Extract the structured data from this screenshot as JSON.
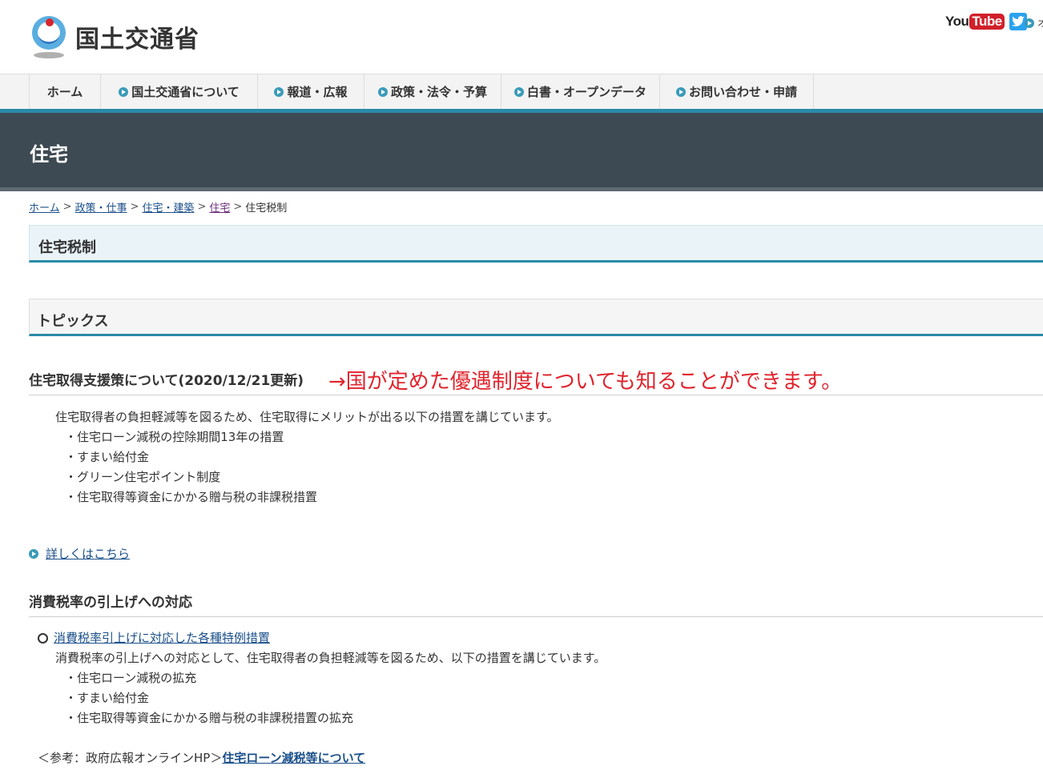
{
  "header": {
    "logo_text": "国土交通省",
    "youtube_you": "You",
    "youtube_tube": "Tube",
    "top_link_label": "オ"
  },
  "gnav": {
    "items": [
      {
        "label": "ホーム"
      },
      {
        "label": "国土交通省について"
      },
      {
        "label": "報道・広報"
      },
      {
        "label": "政策・法令・予算"
      },
      {
        "label": "白書・オープンデータ"
      },
      {
        "label": "お問い合わせ・申請"
      }
    ]
  },
  "banner": {
    "title": "住宅"
  },
  "breadcrumb": {
    "items": [
      "ホーム",
      "政策・仕事",
      "住宅・建築",
      "住宅"
    ],
    "current": "住宅税制",
    "separator": ">"
  },
  "page_title": "住宅税制",
  "topics_heading": "トピックス",
  "section1": {
    "heading": "住宅取得支援策について(2020/12/21更新)",
    "annotation": "→国が定めた優遇制度についても知ることができます。",
    "intro": "住宅取得者の負担軽減等を図るため、住宅取得にメリットが出る以下の措置を講じています。",
    "items": [
      "・住宅ローン減税の控除期間13年の措置",
      "・すまい給付金",
      "・グリーン住宅ポイント制度",
      "・住宅取得等資金にかかる贈与税の非課税措置"
    ],
    "more_link": "詳しくはこちら"
  },
  "section2": {
    "heading": "消費税率の引上げへの対応",
    "link": "消費税率引上げに対応した各種特例措置",
    "intro": "消費税率の引上げへの対応として、住宅取得者の負担軽減等を図るため、以下の措置を講じています。",
    "items": [
      "・住宅ローン減税の拡充",
      "・すまい給付金",
      "・住宅取得等資金にかかる贈与税の非課税措置の拡充"
    ],
    "ref_prefix": "＜参考：政府広報オンラインHP＞",
    "ref_link": "住宅ローン減税等について"
  },
  "colors": {
    "accent": "#2a8aa8",
    "banner": "#3e4a53",
    "annotation": "#e0242d",
    "link": "#1a4f8a"
  }
}
